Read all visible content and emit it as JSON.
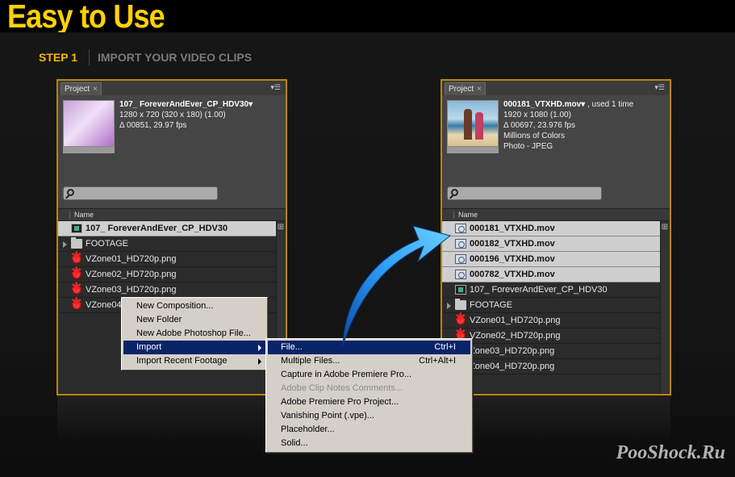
{
  "header": {
    "title": "Easy to Use"
  },
  "step": {
    "label": "STEP 1",
    "description": "IMPORT YOUR VIDEO CLIPS"
  },
  "left_panel": {
    "tab": "Project",
    "info": {
      "name": "107_ ForeverAndEver_CP_HDV30▾",
      "line1": "1280 x 720  (320 x 180) (1.00)",
      "line2": "Δ 00851, 29.97 fps"
    },
    "column": "Name",
    "items": [
      {
        "label": "107_ ForeverAndEver_CP_HDV30",
        "icon": "composition-icon"
      },
      {
        "label": "FOOTAGE",
        "icon": "folder-icon"
      },
      {
        "label": "VZone01_HD720p.png",
        "icon": "photoshop-file-icon"
      },
      {
        "label": "VZone02_HD720p.png",
        "icon": "photoshop-file-icon"
      },
      {
        "label": "VZone03_HD720p.png",
        "icon": "photoshop-file-icon"
      },
      {
        "label": "VZone04",
        "icon": "photoshop-file-icon"
      }
    ]
  },
  "right_panel": {
    "tab": "Project",
    "info": {
      "name": "000181_VTXHD.mov▾",
      "used": " , used 1 time",
      "line1": "1920 x 1080 (1.00)",
      "line2": "Δ 00697, 23.976 fps",
      "line3": "Millions of Colors",
      "line4": "Photo - JPEG"
    },
    "column": "Name",
    "items": [
      {
        "label": "000181_VTXHD.mov",
        "icon": "movie-file-icon"
      },
      {
        "label": "000182_VTXHD.mov",
        "icon": "movie-file-icon"
      },
      {
        "label": "000196_VTXHD.mov",
        "icon": "movie-file-icon"
      },
      {
        "label": "000782_VTXHD.mov",
        "icon": "movie-file-icon"
      },
      {
        "label": "107_ ForeverAndEver_CP_HDV30",
        "icon": "composition-icon"
      },
      {
        "label": "FOOTAGE",
        "icon": "folder-icon"
      },
      {
        "label": "VZone01_HD720p.png",
        "icon": "photoshop-file-icon"
      },
      {
        "label": "VZone02_HD720p.png",
        "icon": "photoshop-file-icon"
      },
      {
        "label": "Zone03_HD720p.png",
        "icon": "photoshop-file-icon"
      },
      {
        "label": "Zone04_HD720p.png",
        "icon": "photoshop-file-icon"
      }
    ]
  },
  "context_menu": {
    "items": [
      "New Composition...",
      "New Folder",
      "New Adobe Photoshop File...",
      "Import",
      "Import Recent Footage"
    ]
  },
  "import_submenu": {
    "items": [
      {
        "label": "File...",
        "shortcut": "Ctrl+I"
      },
      {
        "label": "Multiple Files...",
        "shortcut": "Ctrl+Alt+I"
      },
      {
        "label": "Capture in Adobe Premiere Pro...",
        "shortcut": ""
      },
      {
        "label": "Adobe Clip Notes Comments...",
        "shortcut": ""
      },
      {
        "label": "Adobe Premiere Pro Project...",
        "shortcut": ""
      },
      {
        "label": "Vanishing Point (.vpe)...",
        "shortcut": ""
      },
      {
        "label": "Placeholder...",
        "shortcut": ""
      },
      {
        "label": "Solid...",
        "shortcut": ""
      }
    ]
  },
  "watermark": "PooShock.Ru",
  "colors": {
    "title": "#ffd200",
    "step": "#f5b800",
    "panel_border": "#b8860b",
    "menu_highlight": "#0a246a",
    "arrow": "#2a9df4"
  }
}
